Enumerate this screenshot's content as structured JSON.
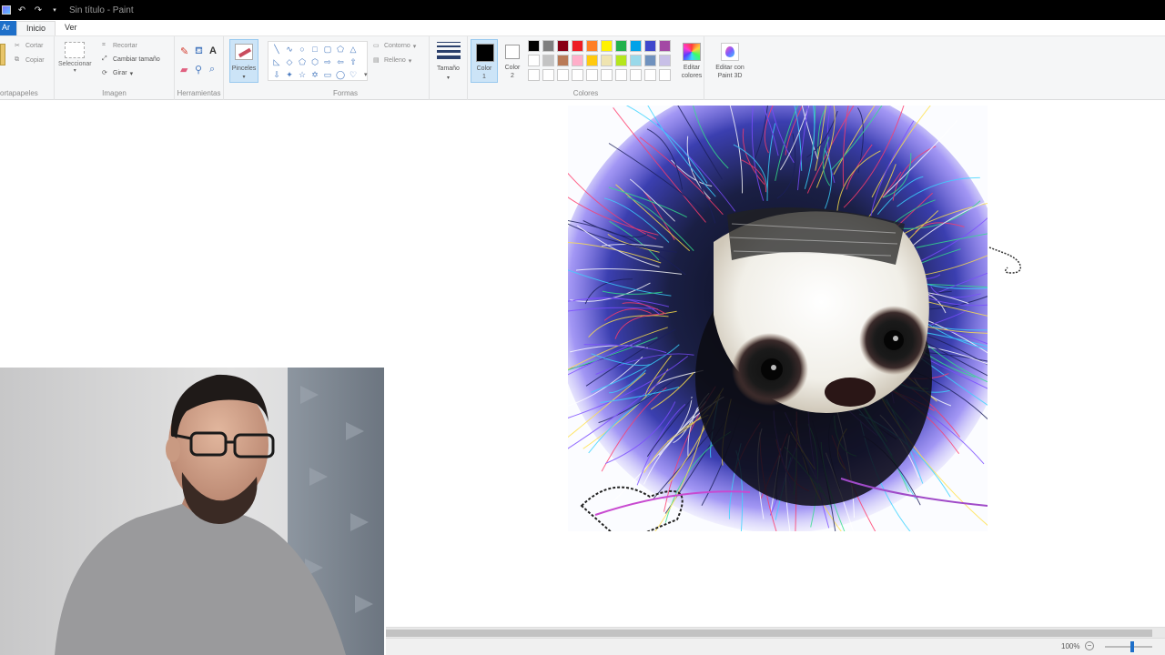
{
  "window": {
    "title": "Sin título - Paint"
  },
  "tabs": [
    {
      "label": "Ar"
    },
    {
      "label": "Inicio"
    },
    {
      "label": "Ver"
    }
  ],
  "ribbon": {
    "clipboard": {
      "cut_label": "Cortar",
      "copy_label": "Copiar",
      "group_label": "ortapapeles"
    },
    "image": {
      "select_label": "Seleccionar",
      "crop_label": "Recortar",
      "resize_label": "Cambiar tamaño",
      "rotate_label": "Girar",
      "group_label": "Imagen"
    },
    "tools": {
      "group_label": "Herramientas"
    },
    "brushes": {
      "label": "Pinceles"
    },
    "shapes": {
      "outline_label": "Contorno",
      "fill_label": "Relleno",
      "group_label": "Formas"
    },
    "size": {
      "label": "Tamaño"
    },
    "colors": {
      "color1_label": "Color",
      "color1_sub": "1",
      "color2_label": "Color",
      "color2_sub": "2",
      "edit_label": "Editar",
      "edit_sub": "colores",
      "group_label": "Colores",
      "color1_value": "#000000",
      "color2_value": "#ffffff",
      "palette_row1": [
        "#000000",
        "#7f7f7f",
        "#880015",
        "#ed1c24",
        "#ff7f27",
        "#fff200",
        "#22b14c",
        "#00a2e8",
        "#3f48cc",
        "#a349a4"
      ],
      "palette_row2": [
        "#ffffff",
        "#c3c3c3",
        "#b97a57",
        "#ffaec9",
        "#ffc90e",
        "#efe4b0",
        "#b5e61d",
        "#99d9ea",
        "#7092be",
        "#c8bfe7"
      ]
    },
    "paint3d": {
      "label": "Editar con",
      "sub": "Paint 3D"
    }
  },
  "status": {
    "zoom": "100%",
    "zoom_out_glyph": "−"
  },
  "icons": {
    "undo": "undo-icon",
    "redo": "redo-icon",
    "pencil": "pencil-icon",
    "fill": "fill-bucket-icon",
    "text": "text-icon",
    "eraser": "eraser-icon",
    "picker": "color-picker-icon",
    "magnifier": "magnifier-icon"
  }
}
